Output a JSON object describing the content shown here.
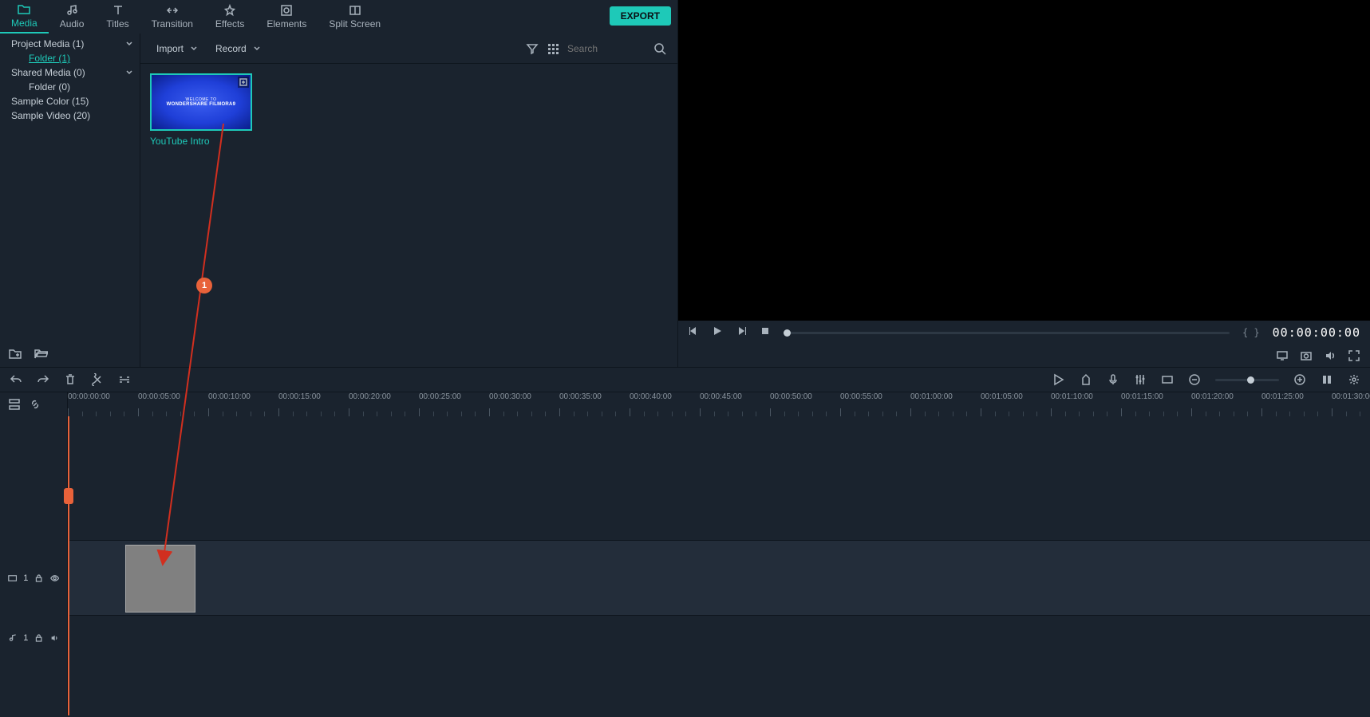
{
  "tabs": {
    "media": "Media",
    "audio": "Audio",
    "titles": "Titles",
    "transition": "Transition",
    "effects": "Effects",
    "elements": "Elements",
    "split_screen": "Split Screen"
  },
  "export_label": "EXPORT",
  "sidebar": {
    "project_media": "Project Media (1)",
    "folder1": "Folder (1)",
    "shared_media": "Shared Media (0)",
    "folder0": "Folder (0)",
    "sample_color": "Sample Color (15)",
    "sample_video": "Sample Video (20)"
  },
  "content_toolbar": {
    "import": "Import",
    "record": "Record",
    "search_placeholder": "Search"
  },
  "thumb": {
    "line1": "WELCOME TO",
    "line2": "WONDERSHARE FILMORA9",
    "label": "YouTube Intro"
  },
  "preview": {
    "timecode": "00:00:00:00",
    "braces": "{  }"
  },
  "ruler": {
    "ticks": [
      "00:00:00:00",
      "00:00:05:00",
      "00:00:10:00",
      "00:00:15:00",
      "00:00:20:00",
      "00:00:25:00",
      "00:00:30:00",
      "00:00:35:00",
      "00:00:40:00",
      "00:00:45:00",
      "00:00:50:00",
      "00:00:55:00",
      "00:01:00:00",
      "00:01:05:00",
      "00:01:10:00",
      "00:01:15:00",
      "00:01:20:00",
      "00:01:25:00",
      "00:01:30:00"
    ]
  },
  "tracks": {
    "video_num": "1",
    "audio_num": "1"
  },
  "annotation": {
    "badge": "1"
  }
}
